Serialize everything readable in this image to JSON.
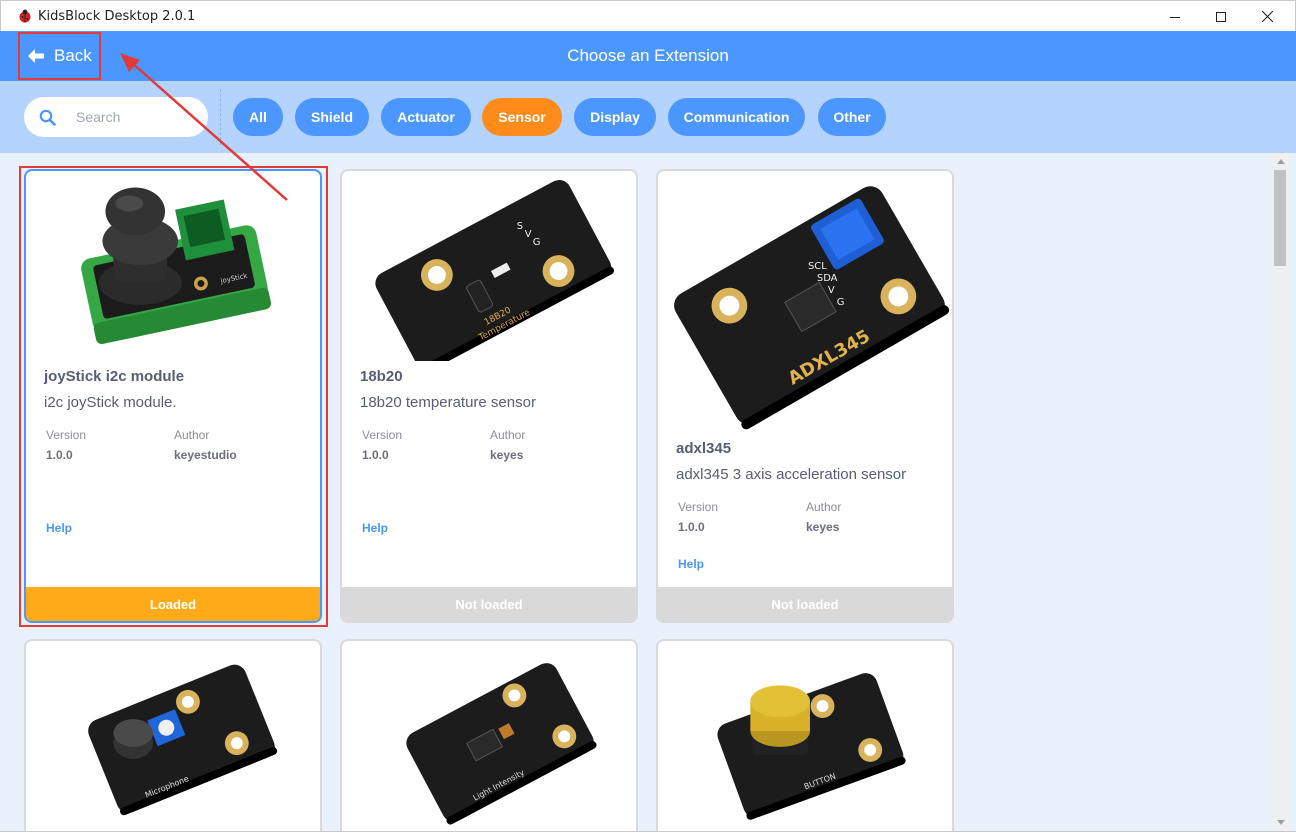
{
  "window": {
    "title": "KidsBlock Desktop 2.0.1"
  },
  "header": {
    "back_label": "Back",
    "title": "Choose an Extension"
  },
  "search": {
    "placeholder": "Search"
  },
  "tags": [
    {
      "label": "All",
      "active": false
    },
    {
      "label": "Shield",
      "active": false
    },
    {
      "label": "Actuator",
      "active": false
    },
    {
      "label": "Sensor",
      "active": true
    },
    {
      "label": "Display",
      "active": false
    },
    {
      "label": "Communication",
      "active": false
    },
    {
      "label": "Other",
      "active": false
    }
  ],
  "cards": [
    {
      "name": "joyStick i2c module",
      "description": "i2c joyStick module.",
      "version_label": "Version",
      "version": "1.0.0",
      "author_label": "Author",
      "author": "keyestudio",
      "help": "Help",
      "status": "Loaded",
      "loaded": true
    },
    {
      "name": "18b20",
      "description": "18b20 temperature sensor",
      "version_label": "Version",
      "version": "1.0.0",
      "author_label": "Author",
      "author": "keyes",
      "help": "Help",
      "status": "Not loaded",
      "loaded": false
    },
    {
      "name": "adxl345",
      "description": "adxl345 3 axis acceleration sensor",
      "version_label": "Version",
      "version": "1.0.0",
      "author_label": "Author",
      "author": "keyes",
      "help": "Help",
      "status": "Not loaded",
      "loaded": false
    },
    {
      "image_label": "Microphone"
    },
    {
      "image_label": "Light Intensity"
    },
    {
      "image_label": "BUTTON"
    }
  ],
  "image_text": {
    "t18b20_pins": [
      "S",
      "V",
      "G"
    ],
    "t18b20_label": [
      "18B20",
      "Temperature"
    ],
    "adxl_label": "ADXL345",
    "adxl_pins": [
      "SCL",
      "SDA",
      "V",
      "G"
    ],
    "joystick_label": "joyStick"
  },
  "colors": {
    "accent": "#4c97ff",
    "active_tag": "#ff8c1a",
    "loaded": "#ffab19",
    "not_loaded": "#d9d9d9",
    "annotation": "#e23a3a"
  }
}
